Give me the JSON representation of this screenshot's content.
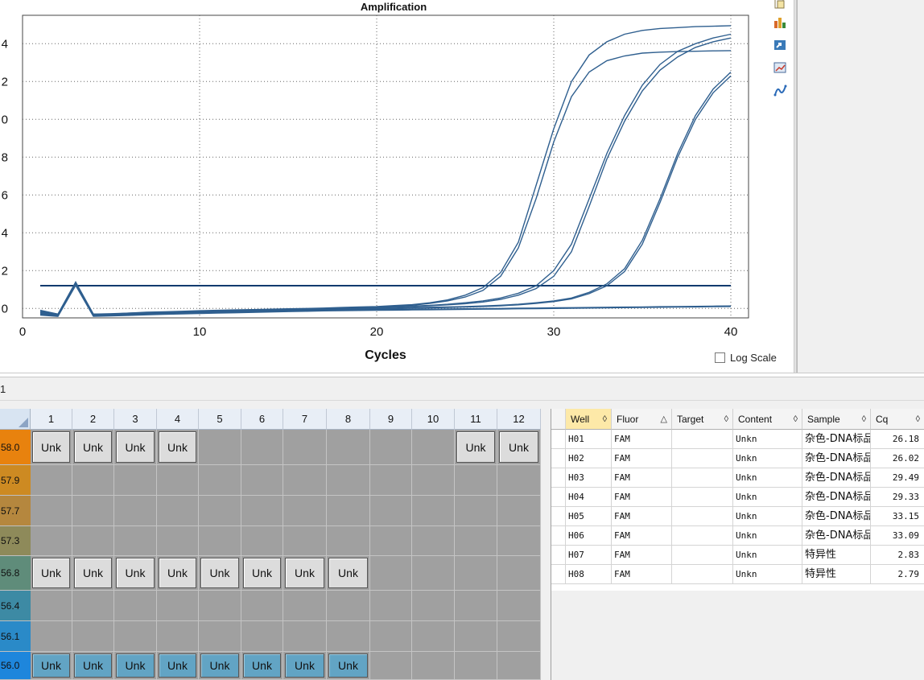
{
  "chart_data": {
    "type": "line",
    "title": "Amplification",
    "xlabel": "Cycles",
    "ylabel": "",
    "xlim": [
      0,
      41
    ],
    "ylim": [
      -0.5,
      15.5
    ],
    "x_ticks": [
      0,
      10,
      20,
      30,
      40
    ],
    "y_ticks": [
      0,
      2,
      4,
      6,
      8,
      10,
      12,
      14
    ],
    "y_tick_labels": [
      "0",
      "2",
      "4",
      "6",
      "8",
      "0",
      "2",
      "4"
    ],
    "threshold": 1.2,
    "grid": true,
    "x": [
      1,
      2,
      3,
      4,
      5,
      6,
      7,
      8,
      9,
      10,
      11,
      12,
      13,
      14,
      15,
      16,
      17,
      18,
      19,
      20,
      21,
      22,
      23,
      24,
      25,
      26,
      27,
      28,
      29,
      30,
      31,
      32,
      33,
      34,
      35,
      36,
      37,
      38,
      39,
      40
    ],
    "series": [
      {
        "values": [
          -0.2,
          -0.3,
          1.4,
          -0.3,
          -0.3,
          -0.25,
          -0.2,
          -0.18,
          -0.15,
          -0.12,
          -0.1,
          -0.08,
          -0.06,
          -0.04,
          -0.02,
          0,
          0.02,
          0.05,
          0.08,
          0.1,
          0.15,
          0.2,
          0.3,
          0.45,
          0.7,
          1.1,
          1.9,
          3.5,
          6.5,
          9.5,
          12.0,
          13.4,
          14.1,
          14.5,
          14.7,
          14.8,
          14.85,
          14.9,
          14.92,
          14.95
        ]
      },
      {
        "values": [
          -0.25,
          -0.35,
          1.3,
          -0.35,
          -0.32,
          -0.27,
          -0.22,
          -0.2,
          -0.17,
          -0.14,
          -0.12,
          -0.1,
          -0.08,
          -0.06,
          -0.04,
          -0.02,
          0,
          0.03,
          0.06,
          0.08,
          0.12,
          0.17,
          0.26,
          0.4,
          0.6,
          0.95,
          1.7,
          3.2,
          5.8,
          8.8,
          11.2,
          12.5,
          13.1,
          13.35,
          13.5,
          13.55,
          13.58,
          13.6,
          13.62,
          13.63
        ]
      },
      {
        "values": [
          -0.1,
          -0.3,
          1.35,
          -0.3,
          -0.28,
          -0.25,
          -0.22,
          -0.2,
          -0.18,
          -0.15,
          -0.13,
          -0.11,
          -0.09,
          -0.07,
          -0.05,
          -0.03,
          -0.01,
          0.01,
          0.03,
          0.05,
          0.08,
          0.12,
          0.16,
          0.22,
          0.3,
          0.4,
          0.55,
          0.8,
          1.2,
          2.0,
          3.4,
          5.8,
          8.2,
          10.2,
          11.8,
          12.9,
          13.6,
          14.0,
          14.3,
          14.5
        ]
      },
      {
        "values": [
          -0.15,
          -0.32,
          1.3,
          -0.32,
          -0.3,
          -0.27,
          -0.24,
          -0.21,
          -0.19,
          -0.16,
          -0.14,
          -0.12,
          -0.1,
          -0.08,
          -0.06,
          -0.04,
          -0.02,
          0,
          0.02,
          0.04,
          0.07,
          0.1,
          0.14,
          0.19,
          0.25,
          0.34,
          0.48,
          0.7,
          1.05,
          1.7,
          3.0,
          5.4,
          7.9,
          9.9,
          11.5,
          12.6,
          13.3,
          13.8,
          14.1,
          14.3
        ]
      },
      {
        "values": [
          -0.2,
          -0.35,
          1.3,
          -0.35,
          -0.33,
          -0.3,
          -0.27,
          -0.24,
          -0.22,
          -0.2,
          -0.18,
          -0.16,
          -0.14,
          -0.12,
          -0.1,
          -0.08,
          -0.06,
          -0.04,
          -0.02,
          0,
          0.02,
          0.04,
          0.06,
          0.08,
          0.1,
          0.13,
          0.17,
          0.22,
          0.3,
          0.4,
          0.55,
          0.85,
          1.3,
          2.1,
          3.6,
          5.8,
          8.2,
          10.2,
          11.6,
          12.5
        ]
      },
      {
        "values": [
          -0.25,
          -0.38,
          1.28,
          -0.38,
          -0.36,
          -0.33,
          -0.3,
          -0.27,
          -0.25,
          -0.23,
          -0.21,
          -0.19,
          -0.17,
          -0.15,
          -0.13,
          -0.11,
          -0.09,
          -0.07,
          -0.05,
          -0.03,
          -0.01,
          0.01,
          0.03,
          0.05,
          0.07,
          0.1,
          0.14,
          0.19,
          0.26,
          0.36,
          0.5,
          0.78,
          1.2,
          1.95,
          3.4,
          5.6,
          8.0,
          10.0,
          11.4,
          12.3
        ]
      },
      {
        "values": [
          -0.3,
          -0.4,
          1.25,
          -0.4,
          -0.38,
          -0.35,
          -0.32,
          -0.29,
          -0.27,
          -0.25,
          -0.23,
          -0.21,
          -0.19,
          -0.17,
          -0.15,
          -0.13,
          -0.11,
          -0.09,
          -0.08,
          -0.07,
          -0.06,
          -0.05,
          -0.04,
          -0.03,
          -0.02,
          -0.01,
          0,
          0.01,
          0.02,
          0.03,
          0.04,
          0.05,
          0.06,
          0.07,
          0.08,
          0.09,
          0.1,
          0.11,
          0.12,
          0.13
        ]
      },
      {
        "values": [
          -0.35,
          -0.42,
          1.22,
          -0.42,
          -0.4,
          -0.37,
          -0.34,
          -0.31,
          -0.29,
          -0.27,
          -0.25,
          -0.23,
          -0.21,
          -0.19,
          -0.17,
          -0.15,
          -0.13,
          -0.12,
          -0.11,
          -0.1,
          -0.09,
          -0.08,
          -0.07,
          -0.06,
          -0.05,
          -0.04,
          -0.03,
          -0.02,
          -0.01,
          0,
          0.01,
          0.02,
          0.03,
          0.04,
          0.05,
          0.06,
          0.07,
          0.08,
          0.09,
          0.1
        ]
      }
    ]
  },
  "log_scale_label": "Log Scale",
  "strip_label": "1",
  "plate": {
    "columns": [
      "1",
      "2",
      "3",
      "4",
      "5",
      "6",
      "7",
      "8",
      "9",
      "10",
      "11",
      "12"
    ],
    "rows": [
      {
        "label": "58.0",
        "color": "#e8820e",
        "wells": [
          "Unk",
          "Unk",
          "Unk",
          "Unk",
          "",
          "",
          "",
          "",
          "",
          "",
          "Unk",
          "Unk"
        ],
        "style": "gray"
      },
      {
        "label": "57.9",
        "color": "#cd8a22",
        "wells": [
          "",
          "",
          "",
          "",
          "",
          "",
          "",
          "",
          "",
          "",
          "",
          ""
        ],
        "style": "gray"
      },
      {
        "label": "57.7",
        "color": "#b5873e",
        "wells": [
          "",
          "",
          "",
          "",
          "",
          "",
          "",
          "",
          "",
          "",
          "",
          ""
        ],
        "style": "gray"
      },
      {
        "label": "57.3",
        "color": "#8e8a5a",
        "wells": [
          "",
          "",
          "",
          "",
          "",
          "",
          "",
          "",
          "",
          "",
          "",
          ""
        ],
        "style": "gray"
      },
      {
        "label": "56.8",
        "color": "#5f8c7a",
        "wells": [
          "Unk",
          "Unk",
          "Unk",
          "Unk",
          "Unk",
          "Unk",
          "Unk",
          "Unk",
          "",
          "",
          "",
          ""
        ],
        "style": "gray"
      },
      {
        "label": "56.4",
        "color": "#3d8aa4",
        "wells": [
          "",
          "",
          "",
          "",
          "",
          "",
          "",
          "",
          "",
          "",
          "",
          ""
        ],
        "style": "gray"
      },
      {
        "label": "56.1",
        "color": "#2a8ac8",
        "wells": [
          "",
          "",
          "",
          "",
          "",
          "",
          "",
          "",
          "",
          "",
          "",
          ""
        ],
        "style": "gray"
      },
      {
        "label": "56.0",
        "color": "#1e86dc",
        "wells": [
          "Unk",
          "Unk",
          "Unk",
          "Unk",
          "Unk",
          "Unk",
          "Unk",
          "Unk",
          "",
          "",
          "",
          ""
        ],
        "style": "blue"
      }
    ]
  },
  "results": {
    "headers": [
      {
        "label": "Well",
        "sort": "◊"
      },
      {
        "label": "Fluor",
        "sort": "△"
      },
      {
        "label": "Target",
        "sort": "◊"
      },
      {
        "label": "Content",
        "sort": "◊"
      },
      {
        "label": "Sample",
        "sort": "◊"
      },
      {
        "label": "Cq",
        "sort": "◊"
      }
    ],
    "rows": [
      [
        "H01",
        "FAM",
        "",
        "Unkn",
        "杂色-DNA标品",
        "26.18"
      ],
      [
        "H02",
        "FAM",
        "",
        "Unkn",
        "杂色-DNA标品",
        "26.02"
      ],
      [
        "H03",
        "FAM",
        "",
        "Unkn",
        "杂色-DNA标品",
        "29.49"
      ],
      [
        "H04",
        "FAM",
        "",
        "Unkn",
        "杂色-DNA标品",
        "29.33"
      ],
      [
        "H05",
        "FAM",
        "",
        "Unkn",
        "杂色-DNA标品",
        "33.15"
      ],
      [
        "H06",
        "FAM",
        "",
        "Unkn",
        "杂色-DNA标品",
        "33.09"
      ],
      [
        "H07",
        "FAM",
        "",
        "Unkn",
        "特异性",
        "2.83"
      ],
      [
        "H08",
        "FAM",
        "",
        "Unkn",
        "特异性",
        "2.79"
      ]
    ]
  },
  "toolbar_icons": [
    "copy-icon",
    "chart-settings-icon",
    "export-icon",
    "zoom-chart-icon",
    "curve-icon"
  ],
  "colors": {
    "curve": "#2f5f8f",
    "threshold": "#0d3a6e",
    "well_header": "#fde9a8"
  }
}
